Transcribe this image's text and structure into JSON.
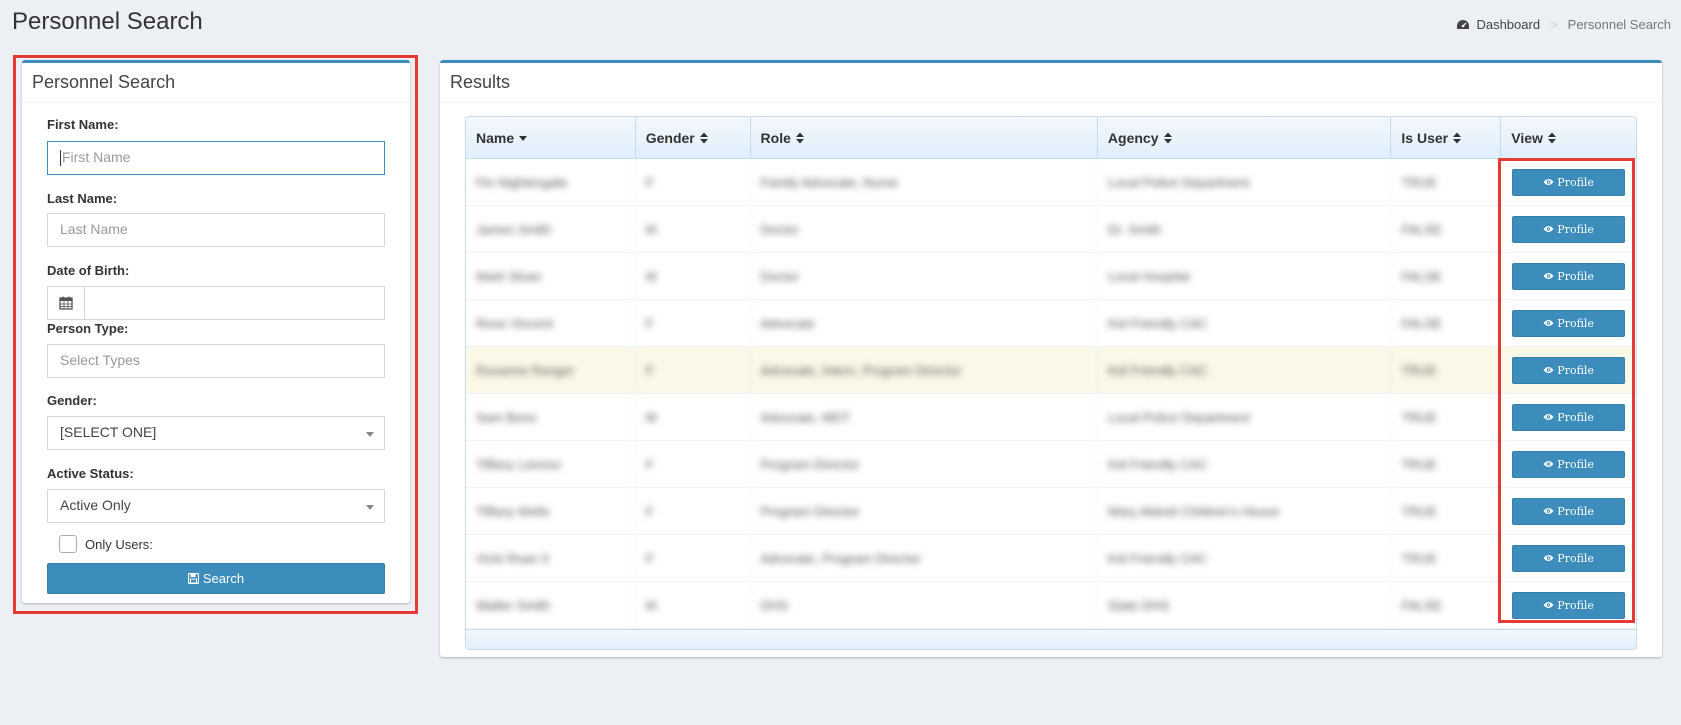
{
  "page": {
    "title": "Personnel Search"
  },
  "breadcrumb": {
    "home": "Dashboard",
    "separator": ">",
    "current": "Personnel Search"
  },
  "search_panel": {
    "title": "Personnel Search",
    "first_name": {
      "label": "First Name:",
      "placeholder": "First Name",
      "value": ""
    },
    "last_name": {
      "label": "Last Name:",
      "placeholder": "Last Name",
      "value": ""
    },
    "dob": {
      "label": "Date of Birth:",
      "value": ""
    },
    "person_type": {
      "label": "Person Type:",
      "placeholder": "Select Types"
    },
    "gender": {
      "label": "Gender:",
      "selected": "[SELECT ONE]"
    },
    "active_status": {
      "label": "Active Status:",
      "selected": "Active Only"
    },
    "only_users": {
      "label": "Only Users:",
      "checked": false
    },
    "search_button": "Search"
  },
  "results": {
    "title": "Results",
    "columns": [
      "Name",
      "Gender",
      "Role",
      "Agency",
      "Is User",
      "View"
    ],
    "rows": [
      {
        "name": "Flo Nightengale",
        "gender": "F",
        "role": "Family Advocate, Nurse",
        "agency": "Local Police Department",
        "is_user": "TRUE",
        "view": "Profile"
      },
      {
        "name": "James Smith",
        "gender": "M",
        "role": "Doctor",
        "agency": "Dr. Smith",
        "is_user": "FALSE",
        "view": "Profile"
      },
      {
        "name": "Mark Sloan",
        "gender": "M",
        "role": "Doctor",
        "agency": "Local Hospital",
        "is_user": "FALSE",
        "view": "Profile"
      },
      {
        "name": "Rose Vincent",
        "gender": "F",
        "role": "Advocate",
        "agency": "Kid Friendly CAC",
        "is_user": "FALSE",
        "view": "Profile"
      },
      {
        "name": "Roxanne Ranger",
        "gender": "F",
        "role": "Advocate, Intern, Program Director",
        "agency": "Kid Friendly CAC",
        "is_user": "TRUE",
        "view": "Profile"
      },
      {
        "name": "Sam Bono",
        "gender": "M",
        "role": "Advocate, MDT",
        "agency": "Local Police Department",
        "is_user": "TRUE",
        "view": "Profile"
      },
      {
        "name": "Tiffany Lennon",
        "gender": "F",
        "role": "Program Director",
        "agency": "Kid Friendly CAC",
        "is_user": "TRUE",
        "view": "Profile"
      },
      {
        "name": "Tiffany Wells",
        "gender": "F",
        "role": "Program Director",
        "agency": "Mary Abbott Children's House",
        "is_user": "TRUE",
        "view": "Profile"
      },
      {
        "name": "Vicki Roan II",
        "gender": "F",
        "role": "Advocate, Program Director",
        "agency": "Kid Friendly CAC",
        "is_user": "TRUE",
        "view": "Profile"
      },
      {
        "name": "Walter Smith",
        "gender": "M",
        "role": "DHS",
        "agency": "State DHS",
        "is_user": "FALSE",
        "view": "Profile"
      }
    ]
  },
  "colors": {
    "primary": "#3c8dbc",
    "highlight": "#e53935",
    "background": "#ecf0f5"
  }
}
